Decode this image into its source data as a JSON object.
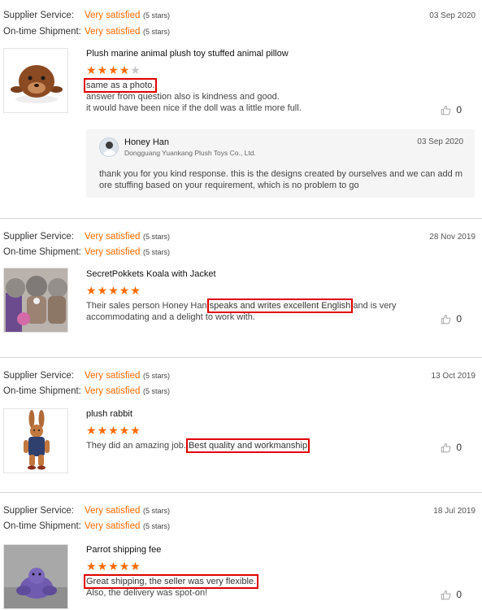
{
  "labels": {
    "supplier_service": "Supplier Service:",
    "ontime_shipment": "On-time Shipment:"
  },
  "colors": {
    "accent": "#ff6a00",
    "highlight_border": "#e00000"
  },
  "reviews": [
    {
      "supplier_rating": "Very satisfied",
      "supplier_stars": "(5 stars)",
      "shipment_rating": "Very satisfied",
      "shipment_stars": "(5 stars)",
      "date": "03 Sep 2020",
      "product_title": "Plush marine animal plush toy stuffed animal pillow",
      "rating": 4,
      "highlight": "same as a photo.",
      "lines": [
        "answer from question also is kindness and good.",
        "it would have been nice if the doll was a little more full."
      ],
      "likes": "0",
      "thumb_icon": "brown-seal-plush-image",
      "reply": {
        "name": "Honey Han",
        "company": "Dongguang Yuankang Plush Toys Co., Ltd.",
        "date": "03 Sep 2020",
        "text": "thank you for you kind response.  this is the designs created by ourselves and we can add more stuffing based on your requirement, which is no problem to go"
      }
    },
    {
      "supplier_rating": "Very satisfied",
      "supplier_stars": "(5 stars)",
      "shipment_rating": "Very satisfied",
      "shipment_stars": "(5 stars)",
      "date": "28 Nov 2019",
      "product_title": "SecretPokkets Koala with Jacket",
      "rating": 5,
      "text_before": "Their sales person Honey Han ",
      "highlight": "speaks and writes excellent English",
      "text_after": " and is very accommodating and a delight to work with.",
      "likes": "0",
      "thumb_icon": "koala-plush-image"
    },
    {
      "supplier_rating": "Very satisfied",
      "supplier_stars": "(5 stars)",
      "shipment_rating": "Very satisfied",
      "shipment_stars": "(5 stars)",
      "date": "13 Oct 2019",
      "product_title": "plush rabbit",
      "rating": 5,
      "text_before": "They did an amazing job. ",
      "highlight": "Best quality and workmanship",
      "text_after": "",
      "likes": "0",
      "thumb_icon": "rabbit-plush-image"
    },
    {
      "supplier_rating": "Very satisfied",
      "supplier_stars": "(5 stars)",
      "shipment_rating": "Very satisfied",
      "shipment_stars": "(5 stars)",
      "date": "18 Jul 2019",
      "product_title": "Parrot shipping fee",
      "rating": 5,
      "highlight": "Great shipping, the seller was very flexible.",
      "lines": [
        "Also, the delivery was spot-on!"
      ],
      "likes": "0",
      "thumb_icon": "purple-plush-image"
    }
  ]
}
